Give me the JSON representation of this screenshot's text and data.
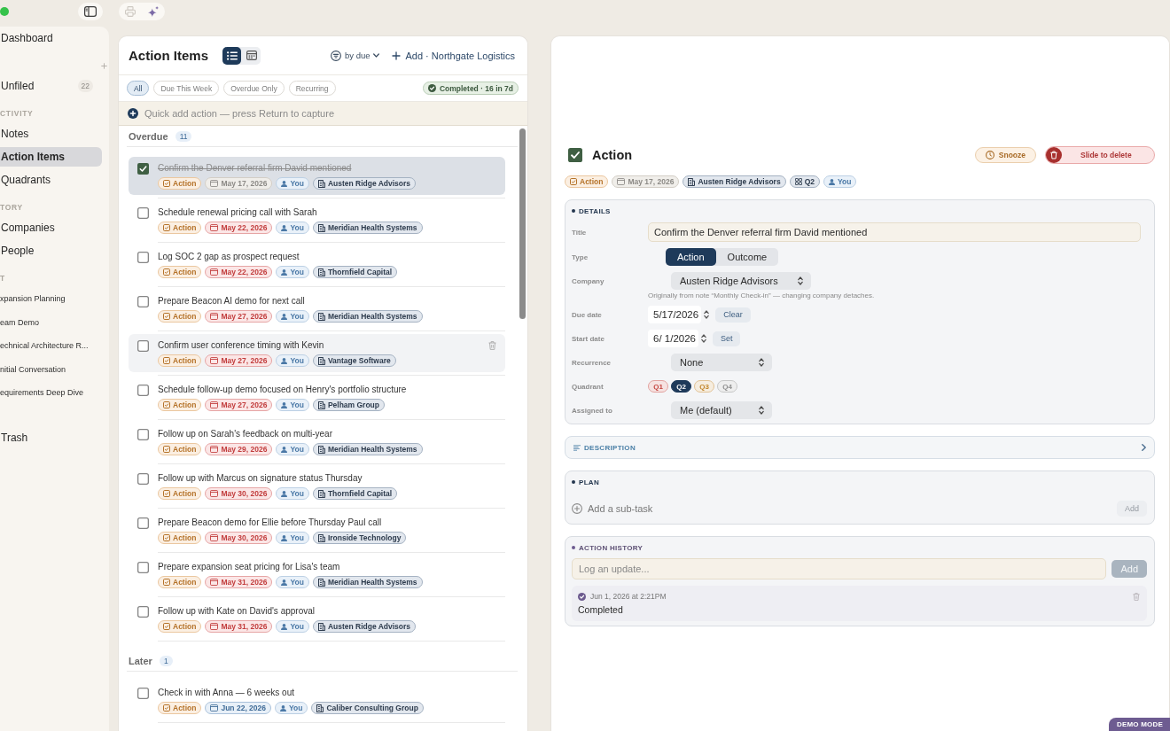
{
  "sidebar": {
    "items": [
      {
        "kind": "item",
        "label": "Dashboard",
        "selected": false
      },
      {
        "kind": "add"
      },
      {
        "kind": "item",
        "label": "Unfiled",
        "badge": "22",
        "selected": false
      },
      {
        "kind": "section",
        "label": "CTIVITY"
      },
      {
        "kind": "item",
        "label": "Notes",
        "selected": false
      },
      {
        "kind": "item",
        "label": "Action Items",
        "selected": true
      },
      {
        "kind": "item",
        "label": "Quadrants",
        "selected": false
      },
      {
        "kind": "section",
        "label": "TORY"
      },
      {
        "kind": "item",
        "label": "Companies",
        "selected": false
      },
      {
        "kind": "item",
        "label": "People",
        "selected": false
      },
      {
        "kind": "section",
        "label": "T"
      },
      {
        "kind": "note",
        "label": "xpansion Planning",
        "selected": false
      },
      {
        "kind": "note",
        "label": "eam Demo",
        "selected": false
      },
      {
        "kind": "note",
        "label": "echnical Architecture R...",
        "selected": false
      },
      {
        "kind": "note",
        "label": "nitial Conversation",
        "selected": false
      },
      {
        "kind": "note",
        "label": "equirements Deep Dive",
        "selected": false
      },
      {
        "kind": "item",
        "label": "Trash",
        "selected": false
      }
    ]
  },
  "list_panel": {
    "title": "Action Items",
    "views": [
      {
        "kind": "list",
        "selected": true
      },
      {
        "kind": "calendar",
        "selected": false
      }
    ],
    "sort": "by due",
    "add": "Add · Northgate Logistics",
    "filters": [
      {
        "label": "All",
        "selected": true
      },
      {
        "label": "Due This Week",
        "selected": false
      },
      {
        "label": "Overdue Only",
        "selected": false
      },
      {
        "label": "Recurring",
        "selected": false
      }
    ],
    "completed": "Completed · 16 in 7d",
    "quick_add": {
      "placeholder": "Quick add action — press Return to capture"
    },
    "groups": [
      {
        "name": "Overdue",
        "count": "11",
        "items": [
          {
            "title": "Confirm the Denver referral firm David mentioned",
            "checked": true,
            "selected": true,
            "hovered": false,
            "type": "Action",
            "due": {
              "kind": "done",
              "label": "May 17, 2026"
            },
            "assignee": "You",
            "company": "Austen Ridge Advisors"
          },
          {
            "title": "Schedule renewal pricing call with Sarah",
            "checked": false,
            "selected": false,
            "hovered": false,
            "type": "Action",
            "due": {
              "kind": "overdue",
              "label": "May 22, 2026"
            },
            "assignee": "You",
            "company": "Meridian Health Systems"
          },
          {
            "title": "Log SOC 2 gap as prospect request",
            "checked": false,
            "selected": false,
            "hovered": false,
            "type": "Action",
            "due": {
              "kind": "overdue",
              "label": "May 22, 2026"
            },
            "assignee": "You",
            "company": "Thornfield Capital"
          },
          {
            "title": "Prepare Beacon AI demo for next call",
            "checked": false,
            "selected": false,
            "hovered": false,
            "type": "Action",
            "due": {
              "kind": "overdue",
              "label": "May 27, 2026"
            },
            "assignee": "You",
            "company": "Meridian Health Systems"
          },
          {
            "title": "Confirm user conference timing with Kevin",
            "checked": false,
            "selected": false,
            "hovered": true,
            "type": "Action",
            "due": {
              "kind": "overdue",
              "label": "May 27, 2026"
            },
            "assignee": "You",
            "company": "Vantage Software"
          },
          {
            "title": "Schedule follow-up demo focused on Henry's portfolio structure",
            "checked": false,
            "selected": false,
            "hovered": false,
            "type": "Action",
            "due": {
              "kind": "overdue",
              "label": "May 27, 2026"
            },
            "assignee": "You",
            "company": "Pelham Group"
          },
          {
            "title": "Follow up on Sarah's feedback on multi-year",
            "checked": false,
            "selected": false,
            "hovered": false,
            "type": "Action",
            "due": {
              "kind": "overdue",
              "label": "May 29, 2026"
            },
            "assignee": "You",
            "company": "Meridian Health Systems"
          },
          {
            "title": "Follow up with Marcus on signature status Thursday",
            "checked": false,
            "selected": false,
            "hovered": false,
            "type": "Action",
            "due": {
              "kind": "overdue",
              "label": "May 30, 2026"
            },
            "assignee": "You",
            "company": "Thornfield Capital"
          },
          {
            "title": "Prepare Beacon demo for Ellie before Thursday Paul call",
            "checked": false,
            "selected": false,
            "hovered": false,
            "type": "Action",
            "due": {
              "kind": "overdue",
              "label": "May 30, 2026"
            },
            "assignee": "You",
            "company": "Ironside Technology"
          },
          {
            "title": "Prepare expansion seat pricing for Lisa's team",
            "checked": false,
            "selected": false,
            "hovered": false,
            "type": "Action",
            "due": {
              "kind": "overdue",
              "label": "May 31, 2026"
            },
            "assignee": "You",
            "company": "Meridian Health Systems"
          },
          {
            "title": "Follow up with Kate on David's approval",
            "checked": false,
            "selected": false,
            "hovered": false,
            "type": "Action",
            "due": {
              "kind": "overdue",
              "label": "May 31, 2026"
            },
            "assignee": "You",
            "company": "Austen Ridge Advisors"
          }
        ]
      },
      {
        "name": "Later",
        "count": "1",
        "items": [
          {
            "title": "Check in with Anna — 6 weeks out",
            "checked": false,
            "selected": false,
            "hovered": false,
            "type": "Action",
            "due": {
              "kind": "upcoming",
              "label": "Jun 22, 2026"
            },
            "assignee": "You",
            "company": "Caliber Consulting Group"
          }
        ]
      }
    ]
  },
  "detail": {
    "checked": true,
    "title": "Action",
    "snooze": "Snooze",
    "delete": "Slide to delete",
    "tags": [
      {
        "kind": "type",
        "label": "Action"
      },
      {
        "kind": "date",
        "label": "May 17, 2026"
      },
      {
        "kind": "company",
        "label": "Austen Ridge Advisors"
      },
      {
        "kind": "quadrant",
        "label": "Q2"
      },
      {
        "kind": "person",
        "label": "You"
      }
    ],
    "details": {
      "heading": "DETAILS",
      "fields": [
        {
          "kind": "text",
          "label": "Title",
          "value": "Confirm the Denver referral firm David mentioned"
        },
        {
          "kind": "segmented",
          "label": "Type",
          "options": [
            {
              "label": "Action",
              "selected": true
            },
            {
              "label": "Outcome",
              "selected": false
            }
          ]
        },
        {
          "kind": "select",
          "label": "Company",
          "value": "Austen Ridge Advisors",
          "note": "Originally from note “Monthly Check-in” — changing company detaches."
        },
        {
          "kind": "date",
          "label": "Due date",
          "value": "5/17/2026",
          "action": "Clear"
        },
        {
          "kind": "date",
          "label": "Start date",
          "value": "6/ 1/2026",
          "action": "Set"
        },
        {
          "kind": "select",
          "label": "Recurrence",
          "value": "None"
        },
        {
          "kind": "chips",
          "label": "Quadrant",
          "options": [
            {
              "label": "Q1",
              "selected": false,
              "color": "#c4453f"
            },
            {
              "label": "Q2",
              "selected": true,
              "color": "#1e3a5a"
            },
            {
              "label": "Q3",
              "selected": false,
              "color": "#c2852a"
            },
            {
              "label": "Q4",
              "selected": false,
              "color": "#8f8f8f"
            }
          ]
        },
        {
          "kind": "select",
          "label": "Assigned to",
          "value": "Me (default)"
        }
      ]
    },
    "description": {
      "heading": "DESCRIPTION",
      "expanded": false
    },
    "plan": {
      "heading": "PLAN",
      "placeholder": "Add a sub-task",
      "button": "Add",
      "button_disabled": true
    },
    "history": {
      "heading": "ACTION HISTORY",
      "placeholder": "Log an update...",
      "button": "Add",
      "button_disabled": true,
      "entries": [
        {
          "time": "Jun 1, 2026 at 2:21PM",
          "text": "Completed"
        }
      ]
    }
  },
  "demo_badge": "DEMO MODE"
}
